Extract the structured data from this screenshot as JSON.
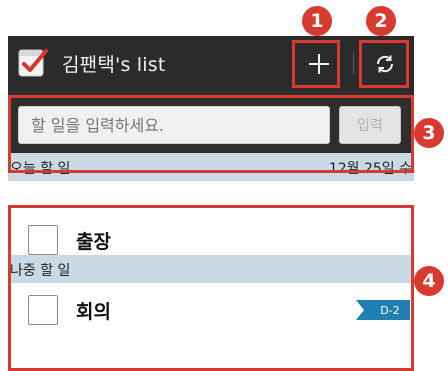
{
  "app": {
    "title": "김팬택's list",
    "icon": "checklist-app-icon"
  },
  "actionbar": {
    "add_icon": "plus-icon",
    "refresh_icon": "refresh-icon"
  },
  "input": {
    "placeholder": "할 일을 입력하세요.",
    "submit_label": "입력"
  },
  "today": {
    "header_label": "오늘 할 일",
    "date": "12월 25일 수",
    "items": [
      {
        "label": "출장",
        "checked": false
      }
    ]
  },
  "later": {
    "header_label": "나중 할 일",
    "items": [
      {
        "label": "회의",
        "checked": false,
        "dday": "D-2"
      }
    ]
  },
  "callouts": [
    "1",
    "2",
    "3",
    "4"
  ],
  "colors": {
    "accent": "#d93a2f",
    "actionbar": "#2b2b2b",
    "section_header": "#c9d9e6",
    "dday_tag": "#1f7fb0"
  }
}
